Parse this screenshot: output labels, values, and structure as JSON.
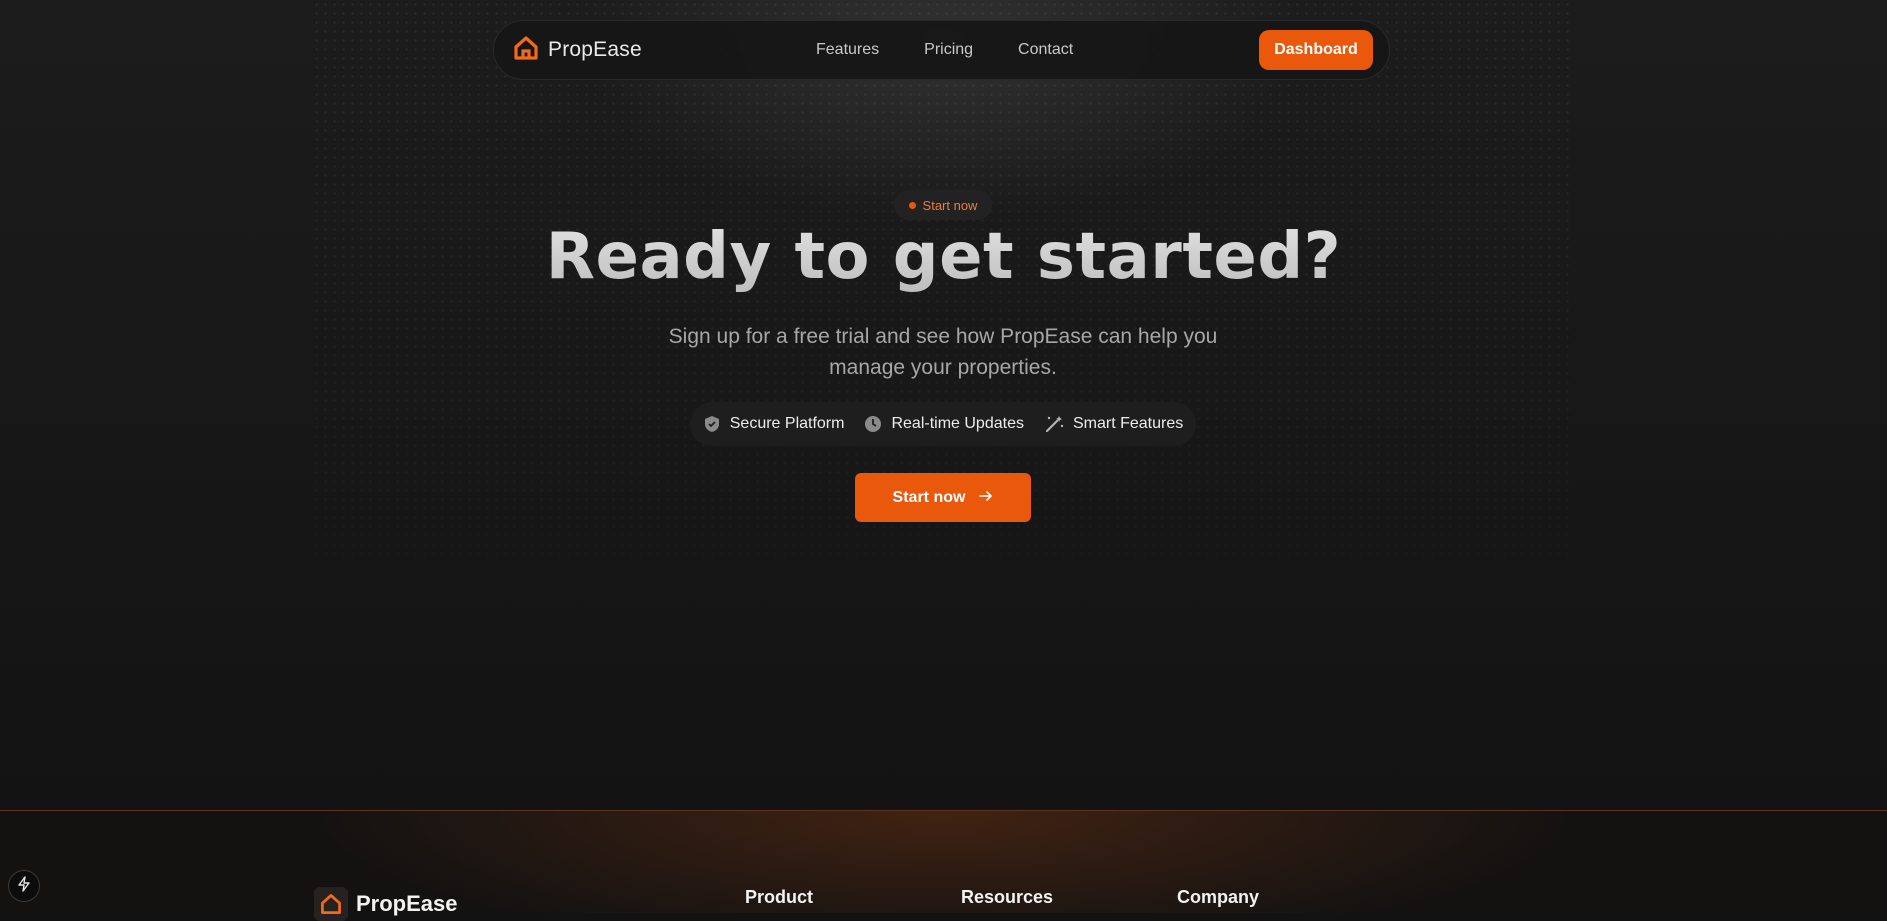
{
  "nav": {
    "brand": "PropEase",
    "links": [
      "Features",
      "Pricing",
      "Contact"
    ],
    "dashboard_label": "Dashboard"
  },
  "hero": {
    "badge": "Start now",
    "title": "Ready to get started?",
    "subtitle": "Sign up for a free trial and see how PropEase can help you manage your properties.",
    "features": [
      {
        "icon": "shield-icon",
        "label": "Secure Platform"
      },
      {
        "icon": "clock-icon",
        "label": "Real-time Updates"
      },
      {
        "icon": "magic-wand-icon",
        "label": "Smart Features"
      }
    ],
    "cta_label": "Start now"
  },
  "footer": {
    "brand": "PropEase",
    "columns": [
      "Product",
      "Resources",
      "Company"
    ]
  },
  "colors": {
    "accent": "#ea580c",
    "background": "#121212"
  }
}
